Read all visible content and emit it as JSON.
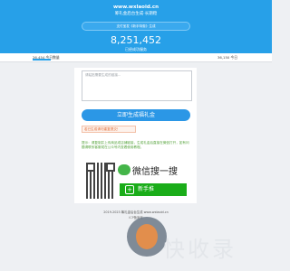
{
  "header": {
    "site": "www.wxlaoid.cn",
    "title": "筹礼金后台生成·长期稳",
    "pill": "支付宝发《新手特惠》生成",
    "counter": "8,251,452",
    "counter_label": "已经成功服务"
  },
  "stats": {
    "left": "26,454 今日数量",
    "right": "36,150 今日",
    "left_fill": 0.5,
    "right_fill": 0.5
  },
  "form": {
    "placeholder": "请粘贴需要生成的链接...",
    "generate": "立即生成福礼金",
    "warning": "若已生成请勿重复提交！",
    "tip": "提示：请复制并上传商品或店铺链接，生成礼金后直接在微信打开，如有问题请联系客服或在公众号内查看使用教程。"
  },
  "promo": {
    "wechat_search": "微信搜一搜",
    "new_btn": "新手推"
  },
  "footer": {
    "line1": "2019-2023 筹礼金后台生成 www.wxlaoid.cn",
    "line2": "ICP备案号"
  },
  "watermark": {
    "text": "快收录"
  },
  "colors": {
    "header": "#27a0e8",
    "button": "#2b97e6",
    "warning": "#e16a33",
    "tip": "#55a33b",
    "wechat": "#1aad19"
  }
}
